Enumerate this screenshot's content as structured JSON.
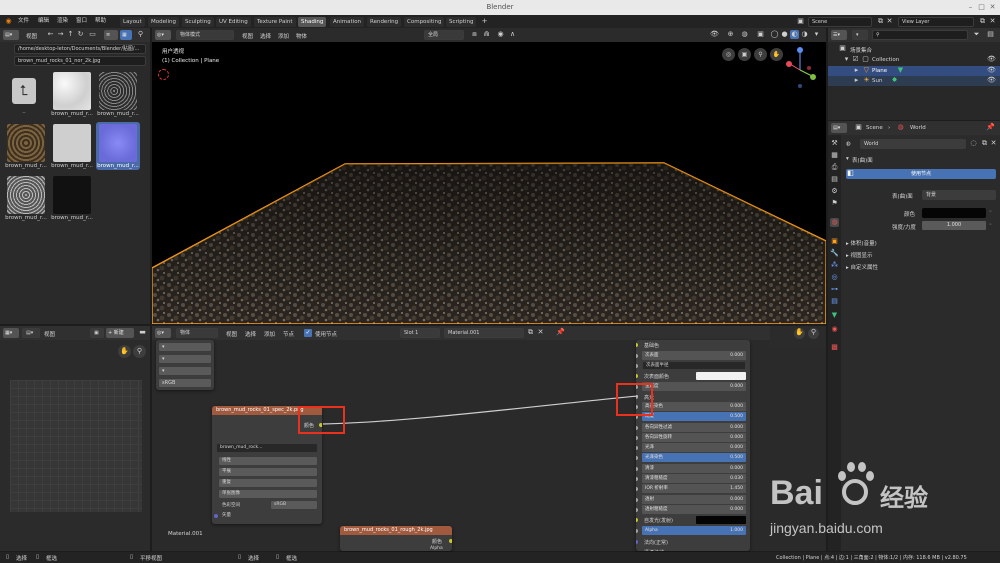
{
  "window": {
    "title": "Blender"
  },
  "menu": [
    "文件",
    "编辑",
    "渲染",
    "窗口",
    "帮助"
  ],
  "workspaces": [
    "Layout",
    "Modeling",
    "Sculpting",
    "UV Editing",
    "Texture Paint",
    "Shading",
    "Animation",
    "Rendering",
    "Compositing",
    "Scripting"
  ],
  "scene_selector": "Scene",
  "view_layer": "View Layer",
  "filebrowser": {
    "view_label": "视图",
    "path": "/home/desktop-leton/Documents/Blender/贴图/...",
    "filename": "brown_mud_rocks_01_nor_2k.jpg",
    "parent_label": "..",
    "items": [
      "brown_mud_r...",
      "brown_mud_r...",
      "brown_mud_r...",
      "brown_mud_r...",
      "brown_mud_r...",
      "brown_mud_r...",
      "brown_mud_r..."
    ]
  },
  "viewport": {
    "mode": "物体模式",
    "menus": [
      "视图",
      "选择",
      "添加",
      "物体"
    ],
    "overlay_title": "用户透视",
    "overlay_subtitle": "(1) Collection | Plane",
    "orientation": "全局"
  },
  "outliner": {
    "root": "场景集合",
    "collection": "Collection",
    "items": [
      "Plane",
      "Sun"
    ]
  },
  "properties": {
    "breadcrumb_scene": "Scene",
    "breadcrumb_world": "World",
    "world_name": "World",
    "section_surface": "表(曲)面",
    "use_nodes": "使用节点",
    "surface_label": "表(曲)面",
    "surface_value": "背景",
    "color_label": "颜色",
    "strength_label": "强度/力度",
    "strength_value": "1.000",
    "panels": [
      "体积(音量)",
      "视图显示",
      "自定义属性"
    ]
  },
  "image_editor": {
    "view_label": "视图",
    "new_label": "+ 新建"
  },
  "node_editor": {
    "object_label": "物体",
    "menus": [
      "视图",
      "选择",
      "添加",
      "节点"
    ],
    "use_nodes": "使用节点",
    "slot": "Slot 1",
    "material": "Material.001",
    "material_label": "Material.001",
    "rgb_value": "sRGB"
  },
  "tex_node": {
    "title": "brown_mud_rocks_01_spec_2k.png",
    "output": "颜色",
    "image_name": "brown_mud_rock...",
    "interp": "线性",
    "proj": "平展",
    "ext": "重复",
    "source": "单张图像",
    "colorspace_label": "色彩空间",
    "colorspace": "sRGB",
    "vector": "矢量"
  },
  "rough_node": {
    "title": "brown_mud_rocks_01_rough_2k.jpg",
    "output": "颜色",
    "output2": "Alpha"
  },
  "bsdf": [
    {
      "label": "基础色",
      "value": "",
      "type": "label"
    },
    {
      "label": "次表面",
      "value": "0.000",
      "type": "field"
    },
    {
      "label": "次表面半径",
      "value": "",
      "type": "dropdown"
    },
    {
      "label": "次表面颜色",
      "value": "",
      "type": "color"
    },
    {
      "label": "金属度",
      "value": "0.000",
      "type": "field"
    },
    {
      "label": "高光",
      "value": "",
      "type": "label"
    },
    {
      "label": "高光染色",
      "value": "0.000",
      "type": "field"
    },
    {
      "label": "糙度",
      "value": "0.500",
      "type": "blue"
    },
    {
      "label": "各向异性过滤",
      "value": "0.000",
      "type": "field"
    },
    {
      "label": "各向异性旋转",
      "value": "0.000",
      "type": "field"
    },
    {
      "label": "光泽",
      "value": "0.000",
      "type": "field"
    },
    {
      "label": "光泽染色",
      "value": "0.500",
      "type": "blue"
    },
    {
      "label": "清漆",
      "value": "0.000",
      "type": "field"
    },
    {
      "label": "清漆粗糙度",
      "value": "0.030",
      "type": "field"
    },
    {
      "label": "IOR 折射率",
      "value": "1.450",
      "type": "field"
    },
    {
      "label": "透射",
      "value": "0.000",
      "type": "field"
    },
    {
      "label": "透射粗糙度",
      "value": "0.000",
      "type": "field"
    },
    {
      "label": "自发光(发射)",
      "value": "",
      "type": "black"
    },
    {
      "label": "Alpha",
      "value": "1.000",
      "type": "blue"
    },
    {
      "label": "法向(正常)",
      "value": "",
      "type": "label"
    },
    {
      "label": "清漆法线",
      "value": "",
      "type": "label"
    }
  ],
  "statusbar": {
    "left": [
      "选择",
      "框选",
      "平移视图",
      "选择",
      "框选"
    ],
    "right": "Collection | Plane | 点:4 | 边:1 | 三角面:2 | 物体:1/2 | 内存: 118.6 MB | v2.80.75"
  },
  "watermark": {
    "brand": "Bai",
    "brand2": "经验",
    "url": "jingyan.baidu.com"
  },
  "colors": {
    "accent": "#4772b3",
    "selection": "#ff9f1c",
    "highlight_box": "#e8321d"
  }
}
